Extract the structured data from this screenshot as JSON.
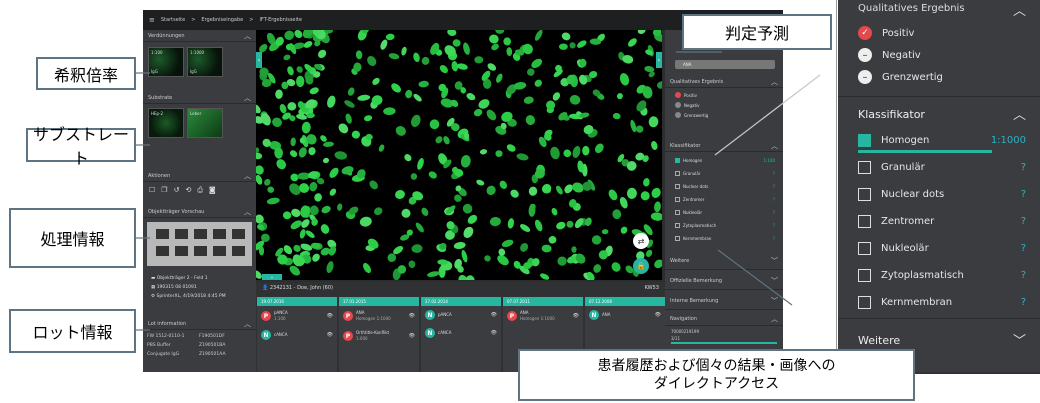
{
  "app": {
    "breadcrumb": [
      "Startseite",
      ">",
      "Ergebniseingabe",
      ">",
      "IFT-Ergebnisseite"
    ],
    "left": {
      "verd_title": "Verdünnungen",
      "thumbs": [
        "1:100",
        "1:1000",
        "IgG",
        "IgG"
      ],
      "substrate_title": "Substrate",
      "substrate_thumbs": [
        "HEp-2",
        "Leber"
      ],
      "actions_title": "Aktionen",
      "slide_title": "Objektträger Vorschau",
      "info": [
        "Objektträger 2 - Feld 1",
        "190315 08 01091",
        "SprinterXL, 4/19/2018 4:45 PM"
      ],
      "lot_title": "Lot information",
      "lots": [
        [
          "FW 1512-0110-1",
          "F190501DF"
        ],
        [
          "PBS Buffer",
          "Z190501BA"
        ],
        [
          "Conjugate IgG",
          "Z190501AA"
        ]
      ]
    },
    "patient": {
      "text": "2342131 - Doe, John (60)",
      "code": "KW53"
    },
    "history": [
      {
        "date": "19.07.2016",
        "items": [
          {
            "b": "P",
            "t": "pANCA",
            "s": "1:100"
          },
          {
            "b": "N",
            "t": "cANCA",
            "s": ""
          }
        ]
      },
      {
        "date": "17.01.2015",
        "items": [
          {
            "b": "P",
            "t": "ANA",
            "s": "Homogen 1:1000"
          },
          {
            "b": "P",
            "t": "Orthtitle-Konflikt",
            "s": "1:000"
          }
        ]
      },
      {
        "date": "27.02.2014",
        "items": [
          {
            "b": "N",
            "t": "pANCA",
            "s": ""
          },
          {
            "b": "N",
            "t": "cANCA",
            "s": ""
          }
        ]
      },
      {
        "date": "07.07.2011",
        "items": [
          {
            "b": "P",
            "t": "ANA",
            "s": "Homogen 1:1000"
          }
        ]
      },
      {
        "date": "07.12.2008",
        "items": [
          {
            "b": "N",
            "t": "ANA",
            "s": ""
          }
        ]
      }
    ],
    "right": {
      "top_label": "ANA",
      "qual_title": "Qualitatives Ergebnis",
      "qual": [
        "Positiv",
        "Negativ",
        "Grenzwertig"
      ],
      "klass_title": "Klassifikator",
      "klass": [
        "Homogen",
        "Granulär",
        "Nuclear dots",
        "Zentromer",
        "Nukleolär",
        "Zytoplasmatisch",
        "Kernmembran"
      ],
      "homogen_value": "1:100",
      "weitere": "Weitere",
      "offizielle": "Offizielle Bemerkung",
      "interne": "Interne Bemerkung",
      "navigation": "Navigation",
      "nav_id": "70000219199",
      "nav_count": "3/11"
    }
  },
  "callouts": {
    "verd": "希釈倍率",
    "sub": "サブストレート",
    "info": "処理情報",
    "lot": "ロット情報",
    "pred": "判定予測",
    "history": "患者履歴および個々の結果・画像への\nダイレクトアクセス"
  },
  "zoom": {
    "qual_title": "Qualitatives Ergebnis",
    "qual": [
      "Positiv",
      "Negativ",
      "Grenzwertig"
    ],
    "klass_title": "Klassifikator",
    "klass": [
      "Homogen",
      "Granulär",
      "Nuclear dots",
      "Zentromer",
      "Nukleolär",
      "Zytoplasmatisch",
      "Kernmembran"
    ],
    "homogen_value": "1:1000",
    "q": "?",
    "weitere": "Weitere"
  },
  "colors": {
    "accent": "#27b7a0",
    "positive": "#e5484d",
    "cell": "#2fbf4a"
  }
}
